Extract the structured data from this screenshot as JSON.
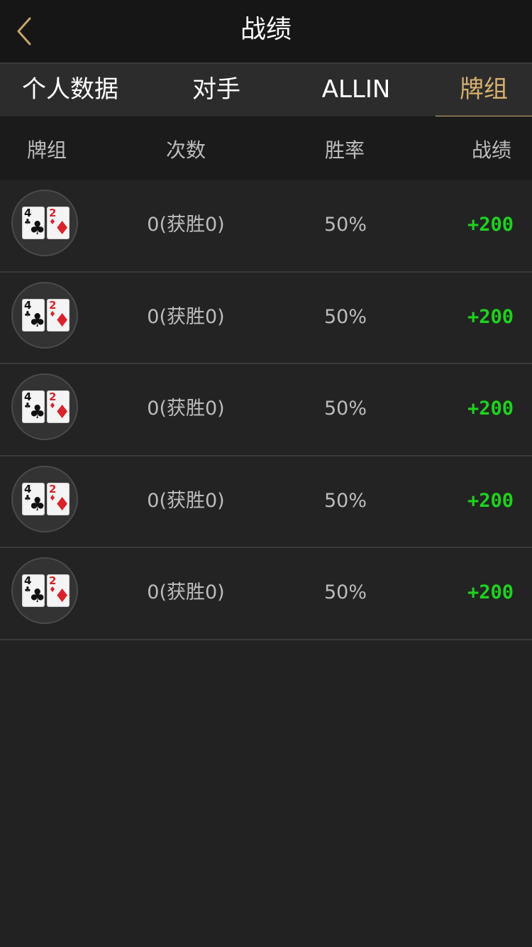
{
  "nav": {
    "title": "战绩"
  },
  "tabs": [
    {
      "label": "个人数据",
      "active": false
    },
    {
      "label": "对手",
      "active": false
    },
    {
      "label": "ALLIN",
      "active": false
    },
    {
      "label": "牌组",
      "active": true
    }
  ],
  "columns": {
    "hand": "牌组",
    "count": "次数",
    "rate": "胜率",
    "score": "战绩"
  },
  "colors": {
    "accent": "#d8b06e",
    "positive": "#1ed21e",
    "heart_diamond": "#d9232a"
  },
  "rows": [
    {
      "cards": [
        {
          "rank": "4",
          "suit": "♣"
        },
        {
          "rank": "2",
          "suit": "♦"
        }
      ],
      "count": "0(获胜0)",
      "rate": "50%",
      "score": "+200"
    },
    {
      "cards": [
        {
          "rank": "4",
          "suit": "♣"
        },
        {
          "rank": "2",
          "suit": "♦"
        }
      ],
      "count": "0(获胜0)",
      "rate": "50%",
      "score": "+200"
    },
    {
      "cards": [
        {
          "rank": "4",
          "suit": "♣"
        },
        {
          "rank": "2",
          "suit": "♦"
        }
      ],
      "count": "0(获胜0)",
      "rate": "50%",
      "score": "+200"
    },
    {
      "cards": [
        {
          "rank": "4",
          "suit": "♣"
        },
        {
          "rank": "2",
          "suit": "♦"
        }
      ],
      "count": "0(获胜0)",
      "rate": "50%",
      "score": "+200"
    },
    {
      "cards": [
        {
          "rank": "4",
          "suit": "♣"
        },
        {
          "rank": "2",
          "suit": "♦"
        }
      ],
      "count": "0(获胜0)",
      "rate": "50%",
      "score": "+200"
    }
  ]
}
